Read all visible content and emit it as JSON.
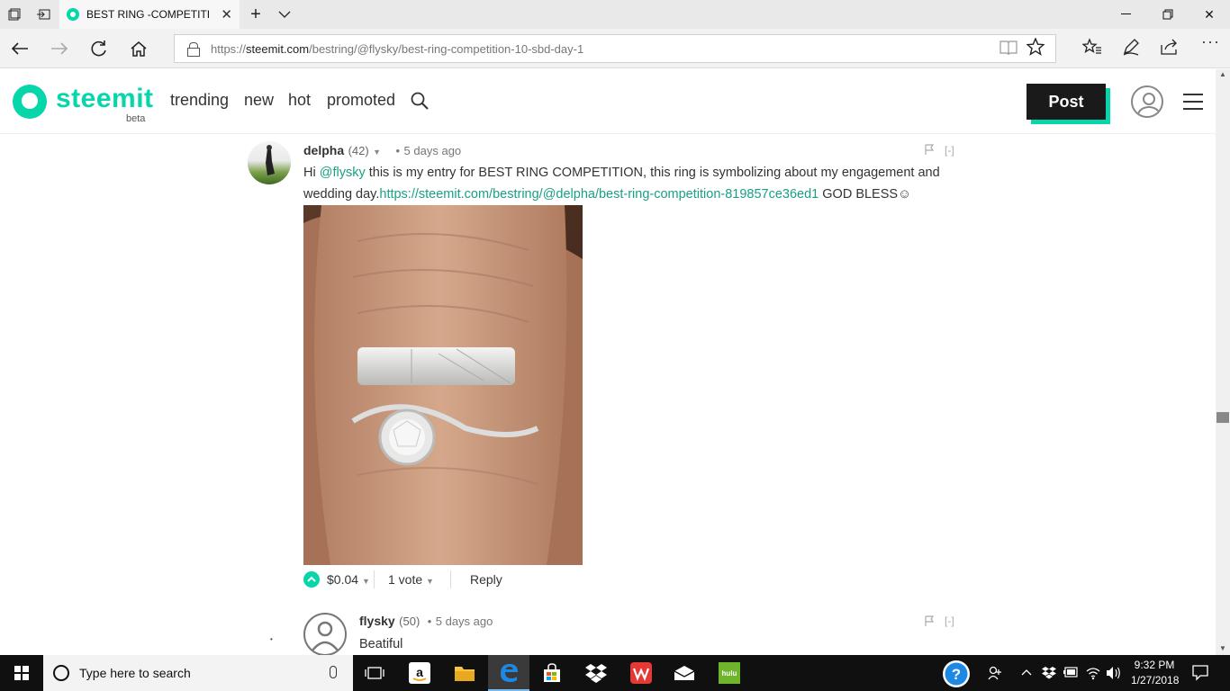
{
  "browser": {
    "tab_title": "BEST RING -COMPETITI",
    "url_prefix": "https://",
    "url_host": "steemit.com",
    "url_path": "/bestring/@flysky/best-ring-competition-10-sbd-day-1",
    "window_controls": [
      "minimize",
      "restore",
      "close"
    ]
  },
  "site": {
    "logo_text": "steemit",
    "logo_sub": "beta",
    "nav": [
      "trending",
      "new",
      "hot",
      "promoted"
    ],
    "post_label": "Post",
    "accent_color": "#06d6a9"
  },
  "comments": [
    {
      "author": "delpha",
      "reputation": "(42)",
      "time": "5 days ago",
      "body_hi": "Hi ",
      "body_mention": "@flysky",
      "body_text": " this is my entry for BEST RING COMPETITION, this ring is symbolizing about my engagement and wedding day.",
      "body_link": "https://steemit.com/bestring/@delpha/best-ring-competition-819857ce36ed1",
      "body_tail": " GOD BLESS☺",
      "payout": "$0.04",
      "votes": "1 vote",
      "reply_label": "Reply",
      "collapse_label": "[-]"
    },
    {
      "author": "flysky",
      "reputation": "(50)",
      "time": "5 days ago",
      "body": "Beatiful",
      "collapse_label": "[-]"
    }
  ],
  "taskbar": {
    "search_placeholder": "Type here to search",
    "time": "9:32 PM",
    "date": "1/27/2018",
    "hulu_label": "hulu"
  }
}
